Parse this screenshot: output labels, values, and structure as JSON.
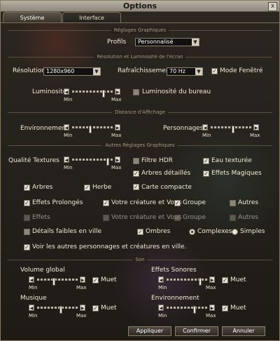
{
  "window": {
    "title": "Options",
    "close_label": "x"
  },
  "tabs": [
    {
      "label": "Système"
    },
    {
      "label": "Interface"
    }
  ],
  "graphics": {
    "section_title": "Réglages Graphiques",
    "profils_label": "Profils",
    "profils_value": "Personnalisé"
  },
  "resolution_section": {
    "title": "Résolution et Luminosité de l'écran",
    "resolution_label": "Résolution",
    "resolution_value": "1280x960",
    "refresh_label": "Rafraîchissement",
    "refresh_value": "70 Hz",
    "window_mode_label": "Mode Fenêtré",
    "brightness_label": "Luminosité",
    "desktop_brightness_label": "Luminosité du bureau"
  },
  "distance_section": {
    "title": "Distance d'Affichage",
    "environment_label": "Environnement",
    "characters_label": "Personnages"
  },
  "other_section": {
    "title": "Autres Réglages Graphiques",
    "texture_quality_label": "Qualité Textures",
    "filtre_hdr": "Filtre HDR",
    "eau_texturee": "Eau texturée",
    "arbres_detailles": "Arbres détaillés",
    "effets_magiques": "Effets Magiques",
    "arbres": "Arbres",
    "herbe": "Herbe",
    "carte_compacte": "Carte compacte",
    "effets_prolonges": "Effets Prolongés",
    "votre_creature_1": "Votre créature et Vous",
    "groupe_1": "Groupe",
    "autres_1": "Autres",
    "effets": "Effets",
    "votre_creature_2": "Votre créature et Vous",
    "groupe_2": "Groupe",
    "autres_2": "Autres",
    "details_faibles": "Détails faibles en ville",
    "ombres": "Ombres",
    "complexes": "Complexes",
    "simples": "Simples",
    "voir_autres": "Voir les autres personnages et créatures en ville."
  },
  "sound_section": {
    "title": "Son",
    "volume_global": "Volume global",
    "effets_sonores": "Effets Sonores",
    "musique": "Musique",
    "environnement": "Environnement",
    "muet": "Muet"
  },
  "slider_labels": {
    "min": "Min",
    "max": "Max"
  },
  "slider_levels": {
    "brightness": 0.8,
    "environment": 0.45,
    "characters": 0.55,
    "texture_quality": 0.9,
    "volume_global": 0.4,
    "effets_sonores": 0.85,
    "musique": 0.6,
    "environnement_sound": 0.7
  },
  "checkbox_mark": "✓",
  "footer": {
    "apply": "Appliquer",
    "confirm": "Confirmer",
    "cancel": "Annuler"
  }
}
